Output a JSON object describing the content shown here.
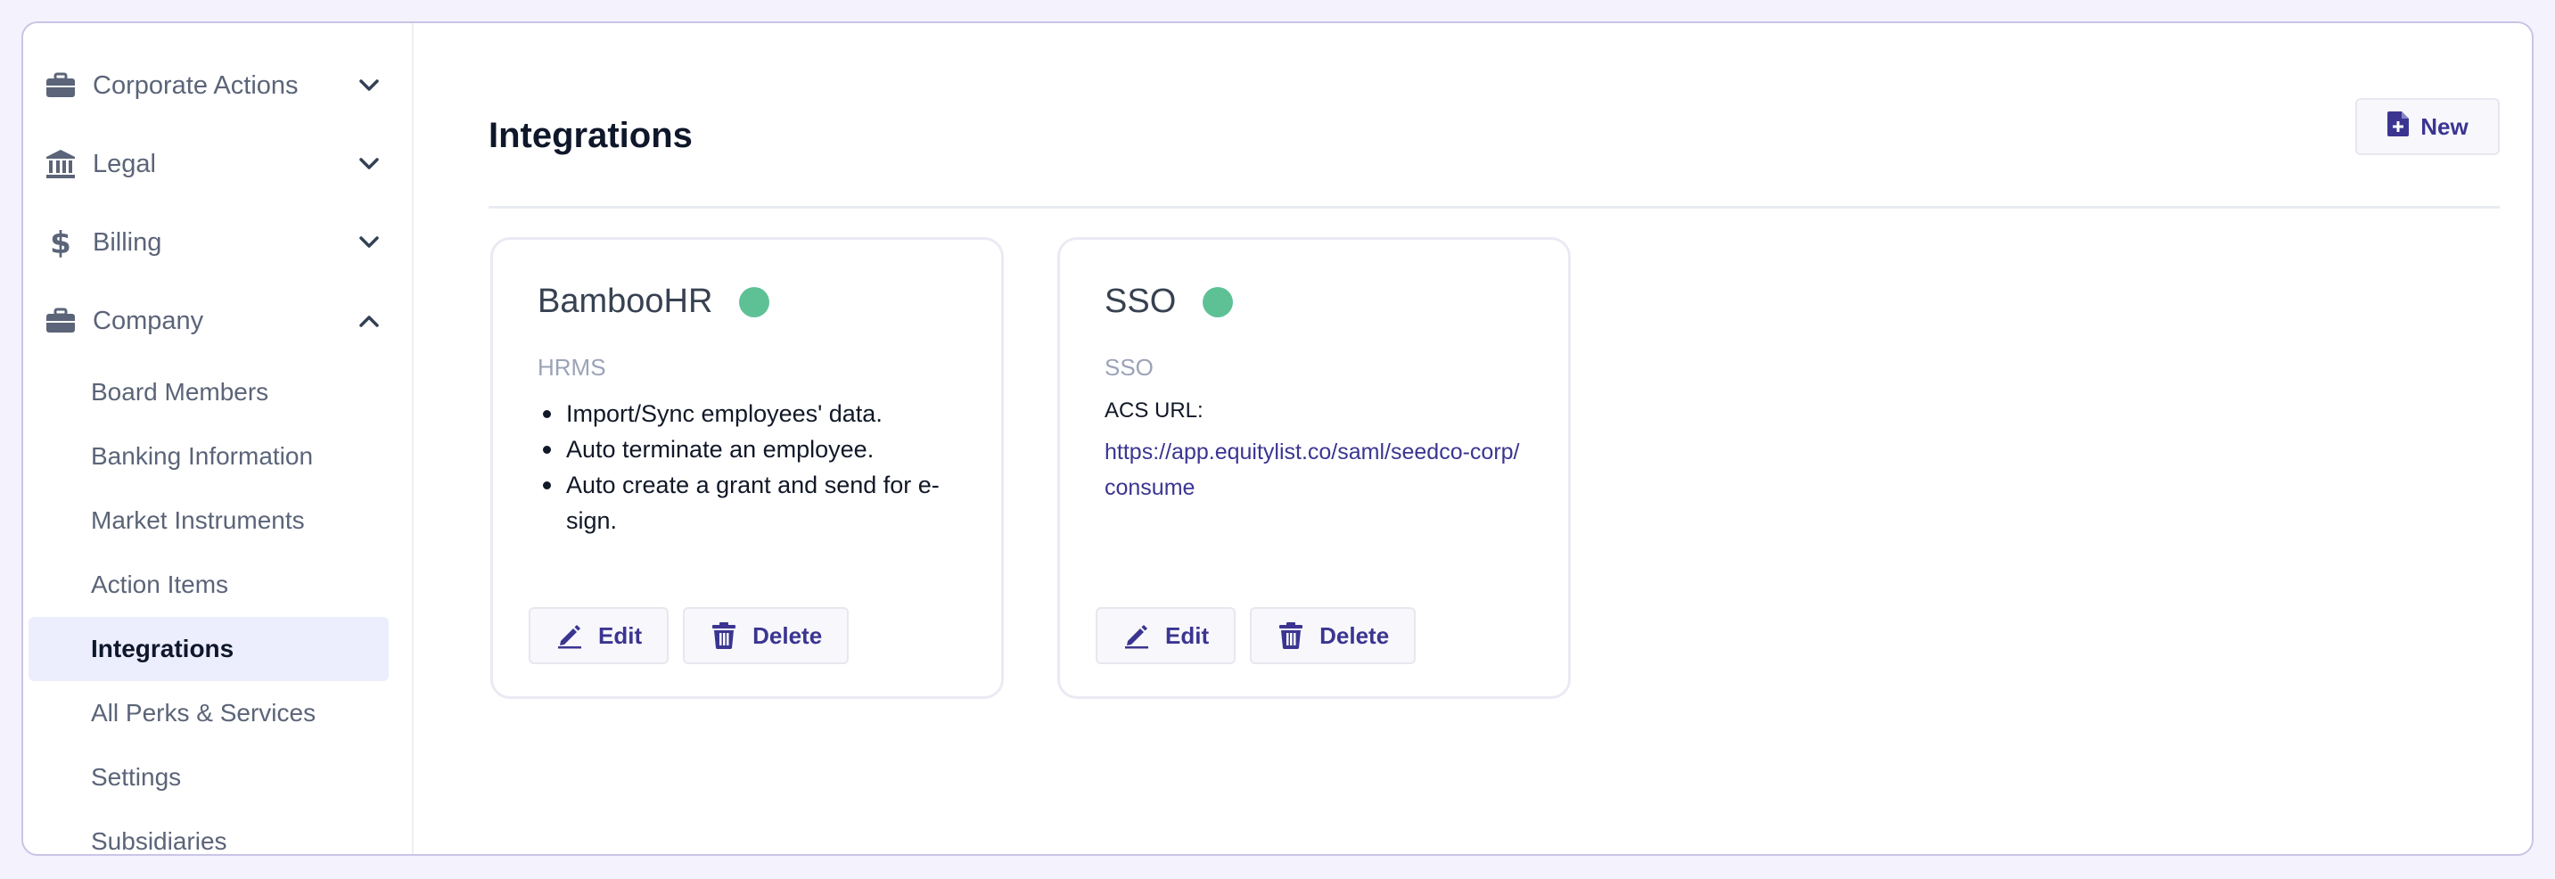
{
  "sidebar": {
    "groups": [
      {
        "label": "Corporate Actions",
        "icon": "briefcase-icon",
        "expanded": false
      },
      {
        "label": "Legal",
        "icon": "bank-icon",
        "expanded": false
      },
      {
        "label": "Billing",
        "icon": "dollar-icon",
        "expanded": false
      },
      {
        "label": "Company",
        "icon": "briefcase-icon",
        "expanded": true
      }
    ],
    "company_items": [
      {
        "label": "Board Members"
      },
      {
        "label": "Banking Information"
      },
      {
        "label": "Market Instruments"
      },
      {
        "label": "Action Items"
      },
      {
        "label": "Integrations",
        "active": true
      },
      {
        "label": "All Perks & Services"
      },
      {
        "label": "Settings"
      },
      {
        "label": "Subsidiaries"
      }
    ]
  },
  "header": {
    "title": "Integrations",
    "new_label": "New"
  },
  "cards": [
    {
      "title": "BambooHR",
      "status_color": "#5ec196",
      "type": "HRMS",
      "features": [
        "Import/Sync employees' data.",
        "Auto terminate an employee.",
        "Auto create a grant and send for e-sign."
      ],
      "edit_label": "Edit",
      "delete_label": "Delete"
    },
    {
      "title": "SSO",
      "status_color": "#5ec196",
      "type": "SSO",
      "acs_label": "ACS URL:",
      "acs_url": "https://app.equitylist.co/saml/seedco-corp/consume",
      "edit_label": "Edit",
      "delete_label": "Delete"
    }
  ],
  "colors": {
    "accent": "#3b3591",
    "active_bg": "#eceefd",
    "status_active": "#5ec196",
    "icon_gray": "#5b6478"
  }
}
